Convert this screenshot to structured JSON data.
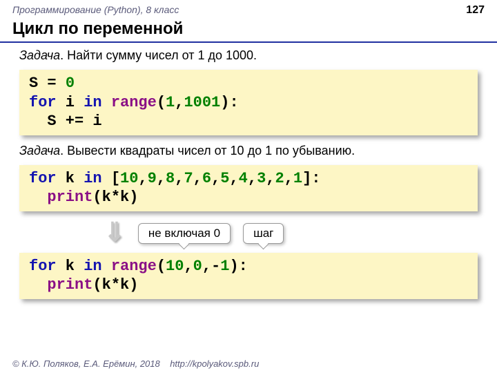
{
  "header": {
    "course": "Программирование (Python), 8 класс",
    "page": "127"
  },
  "title": "Цикл по переменной",
  "task1_label": "Задача",
  "task1_text": ". Найти сумму чисел от 1 до 1000.",
  "code1": {
    "l1a": "S = ",
    "l1b": "0",
    "l2a": "for",
    "l2b": " i ",
    "l2c": "in",
    "l2d": " ",
    "l2e": "range",
    "l2f": "(",
    "l2g": "1",
    "l2h": ",",
    "l2i": "1001",
    "l2j": "):",
    "l3": "  S += i"
  },
  "task2_label": "Задача",
  "task2_text": ". Вывести квадраты чисел от 10 до 1 по убыванию.",
  "code2": {
    "l1a": "for",
    "l1b": " k ",
    "l1c": "in",
    "l1d": " [",
    "l1e": "10",
    "c1": ",",
    "l1f": "9",
    "l1g": "8",
    "l1h": "7",
    "l1i": "6",
    "l1j": "5",
    "l1k": "4",
    "l1l": "3",
    "l1m": "2",
    "l1n": "1",
    "l1z": "]:",
    "l2a": "  ",
    "l2b": "print",
    "l2c": "(k*k)"
  },
  "callout1": "не включая 0",
  "callout2": "шаг",
  "code3": {
    "l1a": "for",
    "l1b": " k ",
    "l1c": "in",
    "l1d": " ",
    "l1e": "range",
    "l1f": "(",
    "l1g": "10",
    "l1h": ",",
    "l1i": "0",
    "l1j": ",-",
    "l1k": "1",
    "l1l": "):",
    "l2a": "  ",
    "l2b": "print",
    "l2c": "(k*k)"
  },
  "footer": {
    "copyright": "© К.Ю. Поляков, Е.А. Ерёмин, 2018",
    "url": "http://kpolyakov.spb.ru"
  }
}
